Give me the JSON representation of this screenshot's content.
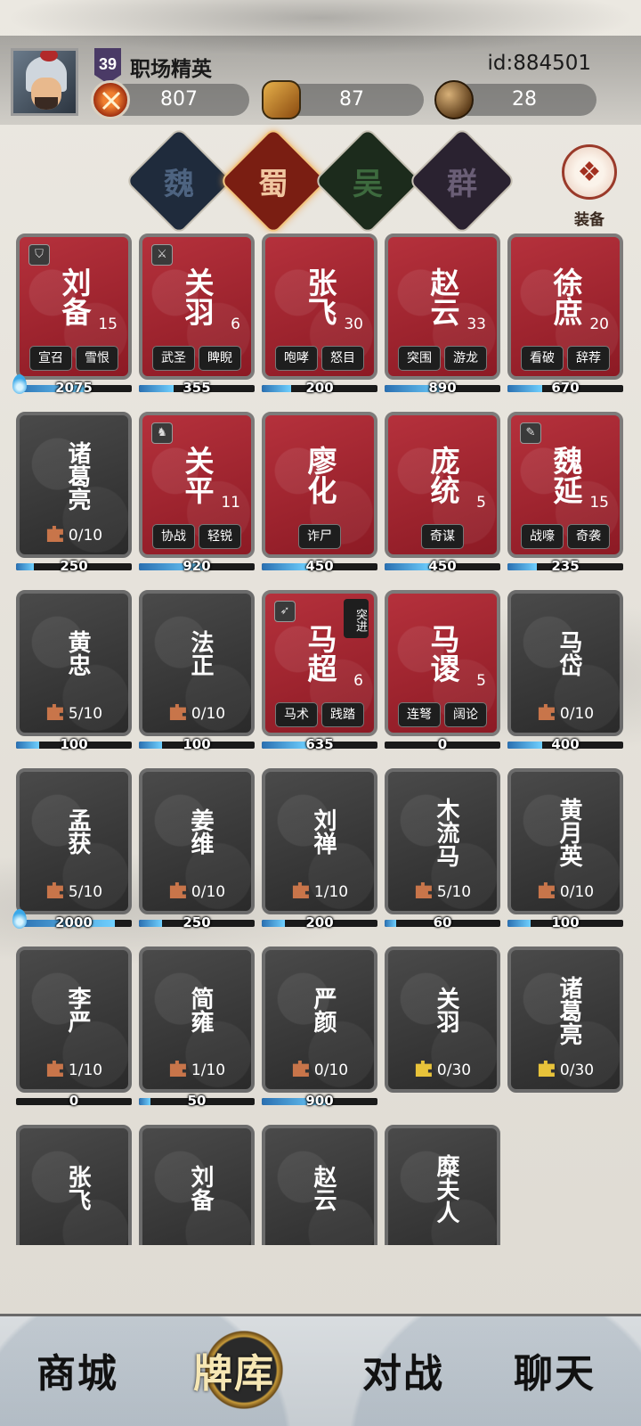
{
  "player": {
    "level": "39",
    "name": "职场精英",
    "id": "id:884501"
  },
  "resources": [
    {
      "icon": "crossed-swords-icon",
      "value": "807"
    },
    {
      "icon": "scroll-icon",
      "value": "87"
    },
    {
      "icon": "orb-icon",
      "value": "28"
    }
  ],
  "factions": [
    {
      "label": "魏",
      "selected": false
    },
    {
      "label": "蜀",
      "selected": true
    },
    {
      "label": "吴",
      "selected": false
    },
    {
      "label": "群",
      "selected": false
    }
  ],
  "equip": {
    "label": "装备"
  },
  "cards": [
    {
      "name": "刘备",
      "owned": true,
      "level": "15",
      "skills": [
        "宣召",
        "雪恨"
      ],
      "bar_value": "2075",
      "bar_fill": 0.6,
      "corner": "shield",
      "drop": true
    },
    {
      "name": "关羽",
      "owned": true,
      "level": "6",
      "skills": [
        "武圣",
        "睥睨"
      ],
      "bar_value": "355",
      "bar_fill": 0.3,
      "corner": "axe"
    },
    {
      "name": "张飞",
      "owned": true,
      "level": "30",
      "skills": [
        "咆哮",
        "怒目"
      ],
      "bar_value": "200",
      "bar_fill": 0.25
    },
    {
      "name": "赵云",
      "owned": true,
      "level": "33",
      "skills": [
        "突围",
        "游龙"
      ],
      "bar_value": "890",
      "bar_fill": 0.5
    },
    {
      "name": "徐庶",
      "owned": true,
      "level": "20",
      "skills": [
        "看破",
        "辞荐"
      ],
      "bar_value": "670",
      "bar_fill": 0.3
    },
    {
      "name": "诸葛亮",
      "owned": false,
      "fragments": "0/10",
      "bar_value": "250",
      "bar_fill": 0.15
    },
    {
      "name": "关平",
      "owned": true,
      "level": "11",
      "skills": [
        "协战",
        "轻锐"
      ],
      "bar_value": "920",
      "bar_fill": 0.55,
      "corner": "horse"
    },
    {
      "name": "廖化",
      "owned": true,
      "level": "",
      "skills": [
        "诈尸"
      ],
      "bar_value": "450",
      "bar_fill": 0.4
    },
    {
      "name": "庞统",
      "owned": true,
      "level": "5",
      "skills": [
        "奇谋"
      ],
      "bar_value": "450",
      "bar_fill": 0.4
    },
    {
      "name": "魏延",
      "owned": true,
      "level": "15",
      "skills": [
        "战嚎",
        "奇袭"
      ],
      "bar_value": "235",
      "bar_fill": 0.25,
      "corner": "blade"
    },
    {
      "name": "黄忠",
      "owned": false,
      "fragments": "5/10",
      "bar_value": "100",
      "bar_fill": 0.2
    },
    {
      "name": "法正",
      "owned": false,
      "fragments": "0/10",
      "bar_value": "100",
      "bar_fill": 0.2
    },
    {
      "name": "马超",
      "owned": true,
      "level": "6",
      "skills": [
        "马术",
        "践踏"
      ],
      "bar_value": "635",
      "bar_fill": 0.4,
      "corner": "spear",
      "breakthrough": "突进"
    },
    {
      "name": "马谡",
      "owned": true,
      "level": "5",
      "skills": [
        "连弩",
        "阔论"
      ],
      "bar_value": "0",
      "bar_fill": 0.0
    },
    {
      "name": "马岱",
      "owned": false,
      "fragments": "0/10",
      "bar_value": "400",
      "bar_fill": 0.3
    },
    {
      "name": "孟获",
      "owned": false,
      "fragments": "5/10",
      "bar_value": "2000",
      "bar_fill": 0.85,
      "drop": true
    },
    {
      "name": "姜维",
      "owned": false,
      "fragments": "0/10",
      "bar_value": "250",
      "bar_fill": 0.2
    },
    {
      "name": "刘禅",
      "owned": false,
      "fragments": "1/10",
      "bar_value": "200",
      "bar_fill": 0.2
    },
    {
      "name": "木流马",
      "owned": false,
      "fragments": "5/10",
      "bar_value": "60",
      "bar_fill": 0.1
    },
    {
      "name": "黄月英",
      "owned": false,
      "fragments": "0/10",
      "bar_value": "100",
      "bar_fill": 0.2
    },
    {
      "name": "李严",
      "owned": false,
      "fragments": "1/10",
      "bar_value": "0",
      "bar_fill": 0.0
    },
    {
      "name": "简雍",
      "owned": false,
      "fragments": "1/10",
      "bar_value": "50",
      "bar_fill": 0.1
    },
    {
      "name": "严颜",
      "owned": false,
      "fragments": "0/10",
      "bar_value": "900",
      "bar_fill": 0.55
    },
    {
      "name": "关羽",
      "owned": false,
      "fragments": "0/30",
      "gold": true
    },
    {
      "name": "诸葛亮",
      "owned": false,
      "fragments": "0/30",
      "gold": true
    },
    {
      "name": "张飞",
      "owned": false
    },
    {
      "name": "刘备",
      "owned": false
    },
    {
      "name": "赵云",
      "owned": false
    },
    {
      "name": "糜夫人",
      "owned": false
    }
  ],
  "nav": [
    {
      "label": "商城",
      "active": false
    },
    {
      "label": "牌库",
      "active": true
    },
    {
      "label": "对战",
      "active": false
    },
    {
      "label": "聊天",
      "active": false
    }
  ]
}
